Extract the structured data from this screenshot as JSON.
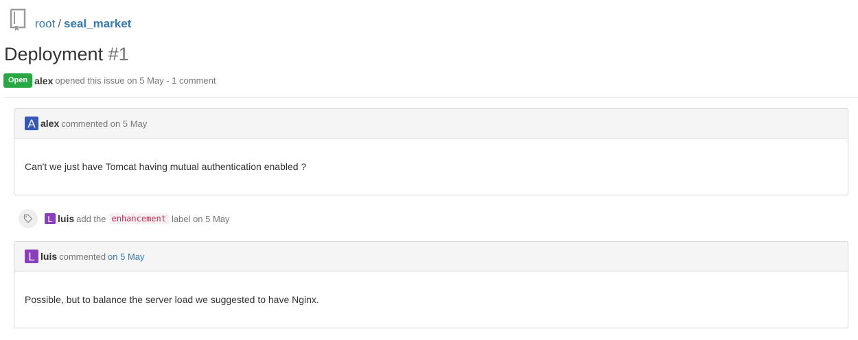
{
  "breadcrumb": {
    "owner": "root",
    "separator": "/",
    "repo": "seal_market"
  },
  "issue": {
    "title": "Deployment",
    "number": "#1",
    "status": "Open",
    "author": "alex",
    "opened_text": "opened this issue on 5 May - 1 comment"
  },
  "comments": [
    {
      "avatar_letter": "A",
      "avatar_color": "#3358b8",
      "author": "alex",
      "header_text": "commented on 5 May",
      "body": "Can't we just have Tomcat having mutual authentication enabled ?"
    },
    {
      "avatar_letter": "L",
      "avatar_color": "#8a3fbc",
      "author": "luis",
      "header_text": "commented",
      "header_link": "on 5 May",
      "body": "Possible, but to balance the server load we suggested to have Nginx."
    }
  ],
  "event": {
    "icon": "tag-icon",
    "avatar_letter": "L",
    "author": "luis",
    "action": "add the",
    "label": "enhancement",
    "suffix": "label on 5 May"
  },
  "colors": {
    "status_green": "#28a745",
    "link_blue": "#337ab7"
  }
}
